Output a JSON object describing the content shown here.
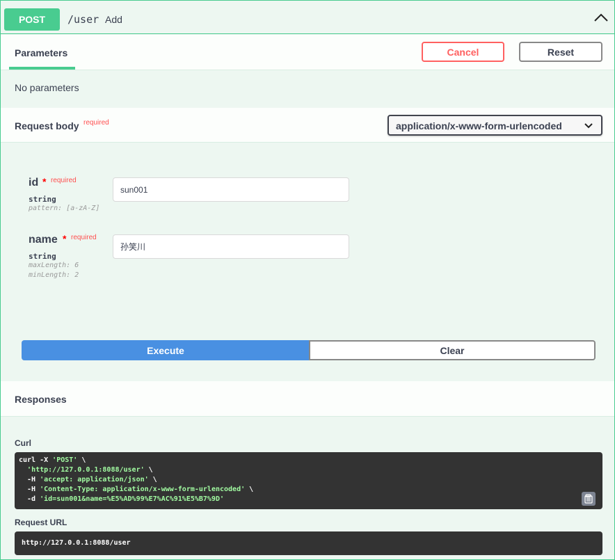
{
  "operation": {
    "method": "POST",
    "path": "/user",
    "description": "Add",
    "collapse_icon": "chevron-up-icon"
  },
  "parameters_section": {
    "tab_label": "Parameters",
    "cancel_label": "Cancel",
    "reset_label": "Reset",
    "empty_text": "No parameters"
  },
  "request_body": {
    "title": "Request body",
    "required_tag": "required",
    "content_type": "application/x-www-form-urlencoded",
    "fields": [
      {
        "name": "id",
        "star": "*",
        "required_tag": "required",
        "type": "string",
        "meta": [
          "pattern: [a-zA-Z]"
        ],
        "value": "sun001"
      },
      {
        "name": "name",
        "star": "*",
        "required_tag": "required",
        "type": "string",
        "meta": [
          "maxLength: 6",
          "minLength: 2"
        ],
        "value": "孙笑川"
      }
    ]
  },
  "actions": {
    "execute_label": "Execute",
    "clear_label": "Clear"
  },
  "responses": {
    "title": "Responses",
    "curl_label": "Curl",
    "curl_lines": [
      [
        "curl -X ",
        "'POST'",
        " \\"
      ],
      [
        "  ",
        "'http://127.0.0.1:8088/user'",
        " \\"
      ],
      [
        "  -H ",
        "'accept: application/json'",
        " \\"
      ],
      [
        "  -H ",
        "'Content-Type: application/x-www-form-urlencoded'",
        " \\"
      ],
      [
        "  -d ",
        "'id=sun001&name=%E5%AD%99%E7%AC%91%E5%B7%9D'",
        ""
      ]
    ],
    "request_url_label": "Request URL",
    "request_url": "http://127.0.0.1:8088/user"
  },
  "colors": {
    "post_green": "#49cc90",
    "execute_blue": "#4990e2",
    "cancel_red": "#ff6060",
    "code_bg": "#333333"
  }
}
